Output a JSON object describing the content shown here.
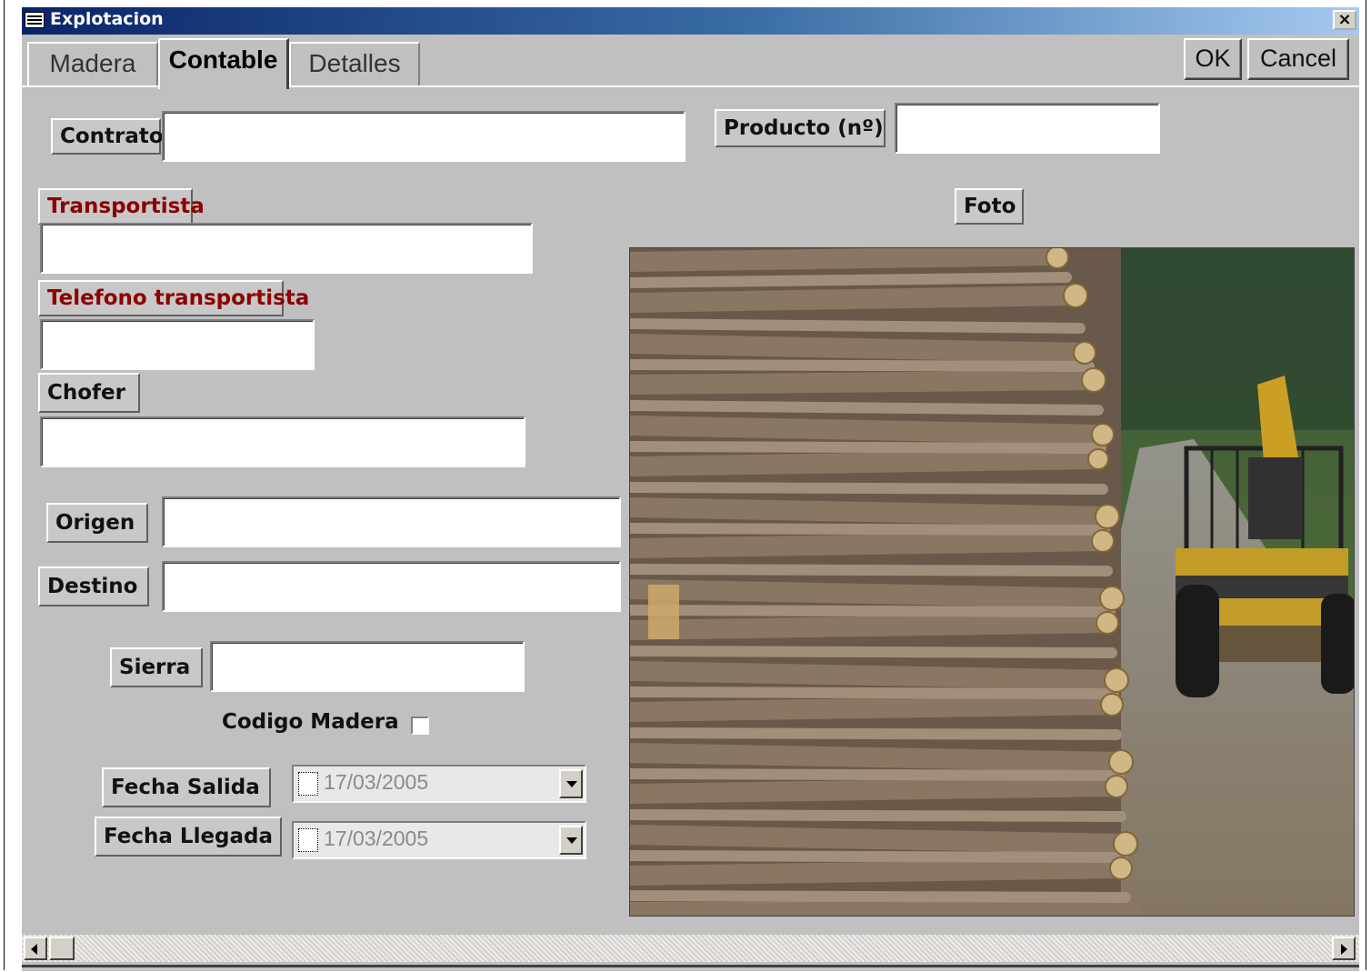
{
  "window": {
    "title": "Explotacion",
    "close_label": "×"
  },
  "tabs": [
    {
      "label": "Madera",
      "active": false
    },
    {
      "label": "Contable",
      "active": true
    },
    {
      "label": "Detalles",
      "active": false
    }
  ],
  "actions": {
    "ok_label": "OK",
    "cancel_label": "Cancel"
  },
  "form": {
    "contrato": {
      "label": "Contrato",
      "value": ""
    },
    "producto": {
      "label": "Producto (nº)",
      "value": ""
    },
    "transportista": {
      "label": "Transportista",
      "value": ""
    },
    "telefono_transportista": {
      "label": "Telefono transportista",
      "value": ""
    },
    "chofer": {
      "label": "Chofer",
      "value": ""
    },
    "origen": {
      "label": "Origen",
      "value": ""
    },
    "destino": {
      "label": "Destino",
      "value": ""
    },
    "sierra": {
      "label": "Sierra",
      "value": ""
    },
    "codigo_madera": {
      "label": "Codigo Madera",
      "checked": false
    },
    "fecha_salida": {
      "label": "Fecha Salida",
      "value": "17/03/2005",
      "enabled": false
    },
    "fecha_llegada": {
      "label": "Fecha Llegada",
      "value": "17/03/2005",
      "enabled": false
    }
  },
  "photo": {
    "label": "Foto"
  },
  "icons": {
    "app": "form-icon",
    "close": "close-icon",
    "dropdown": "chevron-down-icon",
    "scroll_left": "arrow-left-icon",
    "scroll_right": "arrow-right-icon"
  },
  "colors": {
    "titlebar_start": "#0a246a",
    "titlebar_end": "#a6caf0",
    "background": "#c0c0c0",
    "required_label": "#8b0000"
  }
}
